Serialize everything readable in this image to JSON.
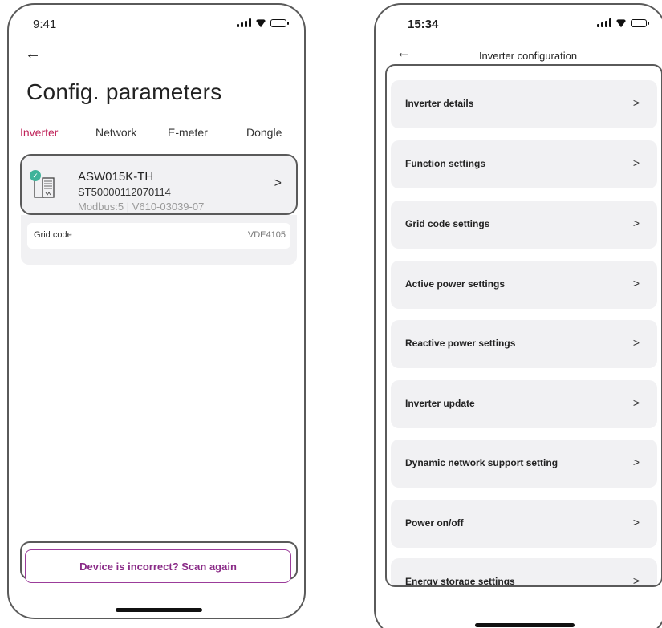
{
  "left_screen": {
    "status_time": "9:41",
    "title": "Config. parameters",
    "tabs": [
      {
        "label": "Inverter",
        "active": true
      },
      {
        "label": "Network",
        "active": false
      },
      {
        "label": "E-meter",
        "active": false
      },
      {
        "label": "Dongle",
        "active": false
      }
    ],
    "device": {
      "model": "ASW015K-TH",
      "serial": "ST50000112070114",
      "meta": "Modbus:5 | V610-03039-07",
      "chevron": ">"
    },
    "grid_code": {
      "label": "Grid code",
      "value": "VDE4105"
    },
    "scan_button": "Device is incorrect? Scan again"
  },
  "right_screen": {
    "status_time": "15:34",
    "title": "Inverter configuration",
    "items": [
      {
        "label": "Inverter details"
      },
      {
        "label": "Function settings"
      },
      {
        "label": "Grid code settings"
      },
      {
        "label": "Active power settings"
      },
      {
        "label": "Reactive power settings"
      },
      {
        "label": "Inverter update"
      },
      {
        "label": "Dynamic network support setting"
      },
      {
        "label": "Power on/off"
      },
      {
        "label": "Energy storage settings"
      }
    ],
    "chevron": ">"
  },
  "icons": {
    "back": "arrow-left-icon",
    "chevron": "chevron-right-icon",
    "signal": "signal-icon",
    "wifi": "wifi-icon",
    "battery": "battery-icon",
    "check": "check-icon",
    "inverter": "inverter-icon"
  },
  "colors": {
    "accent": "#c0245a",
    "scan_button": "#8a2b87",
    "check": "#3fb39a",
    "card_bg": "#f1f1f3"
  }
}
